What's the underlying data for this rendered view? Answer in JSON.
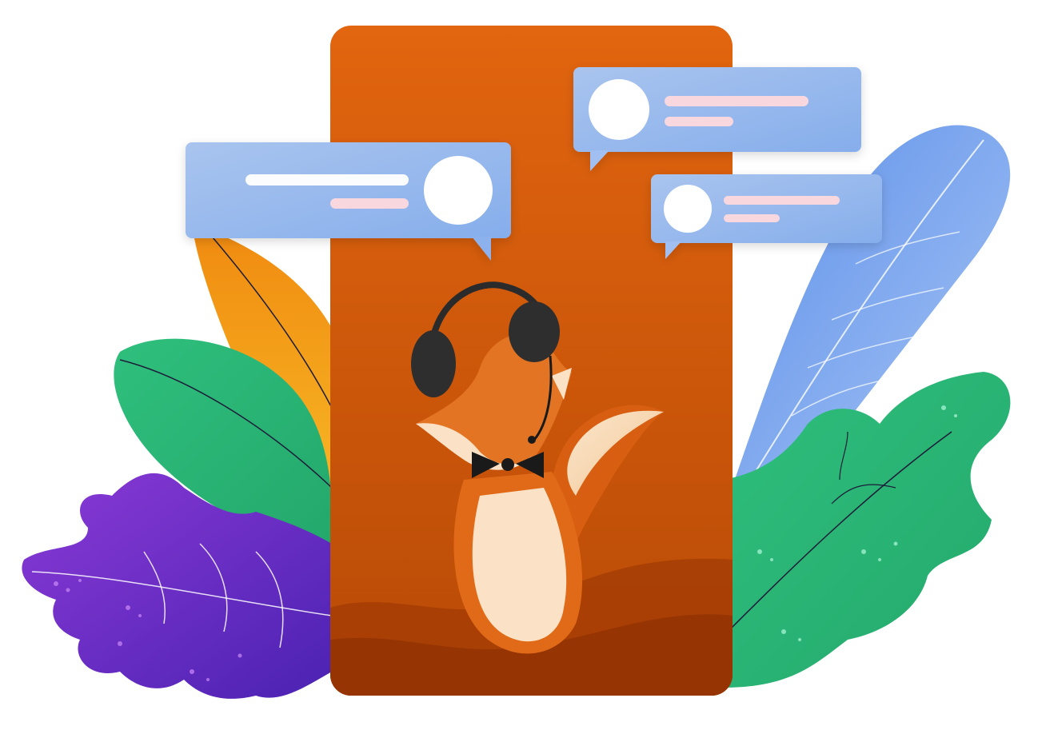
{
  "colors": {
    "background": "#ffffff",
    "phone_top": "#e2650f",
    "phone_bottom": "#b84a06",
    "phone_hill_dark": "#9a3806",
    "bubble_top": "#a9c4ee",
    "bubble_bottom": "#8db1ec",
    "bubble_line": "#f8d8de",
    "bubble_avatar": "#ffffff",
    "leaf_orange": "#f5a21a",
    "leaf_green": "#2fbf7d",
    "leaf_purple": "#6e2bc8",
    "leaf_blue": "#6d9ef0",
    "fox_fur": "#e06a17",
    "fox_belly": "#fbe2c6",
    "headset": "#2b2b2b"
  },
  "icons": {
    "mascot": "fox-with-headset-icon",
    "bubble_avatar": "user-avatar-icon"
  },
  "chat_bubbles": [
    {
      "side": "left-tail-right",
      "avatar": "user-avatar-icon"
    },
    {
      "side": "tail-left",
      "avatar": "user-avatar-icon"
    },
    {
      "side": "tail-left",
      "avatar": "user-avatar-icon"
    }
  ]
}
